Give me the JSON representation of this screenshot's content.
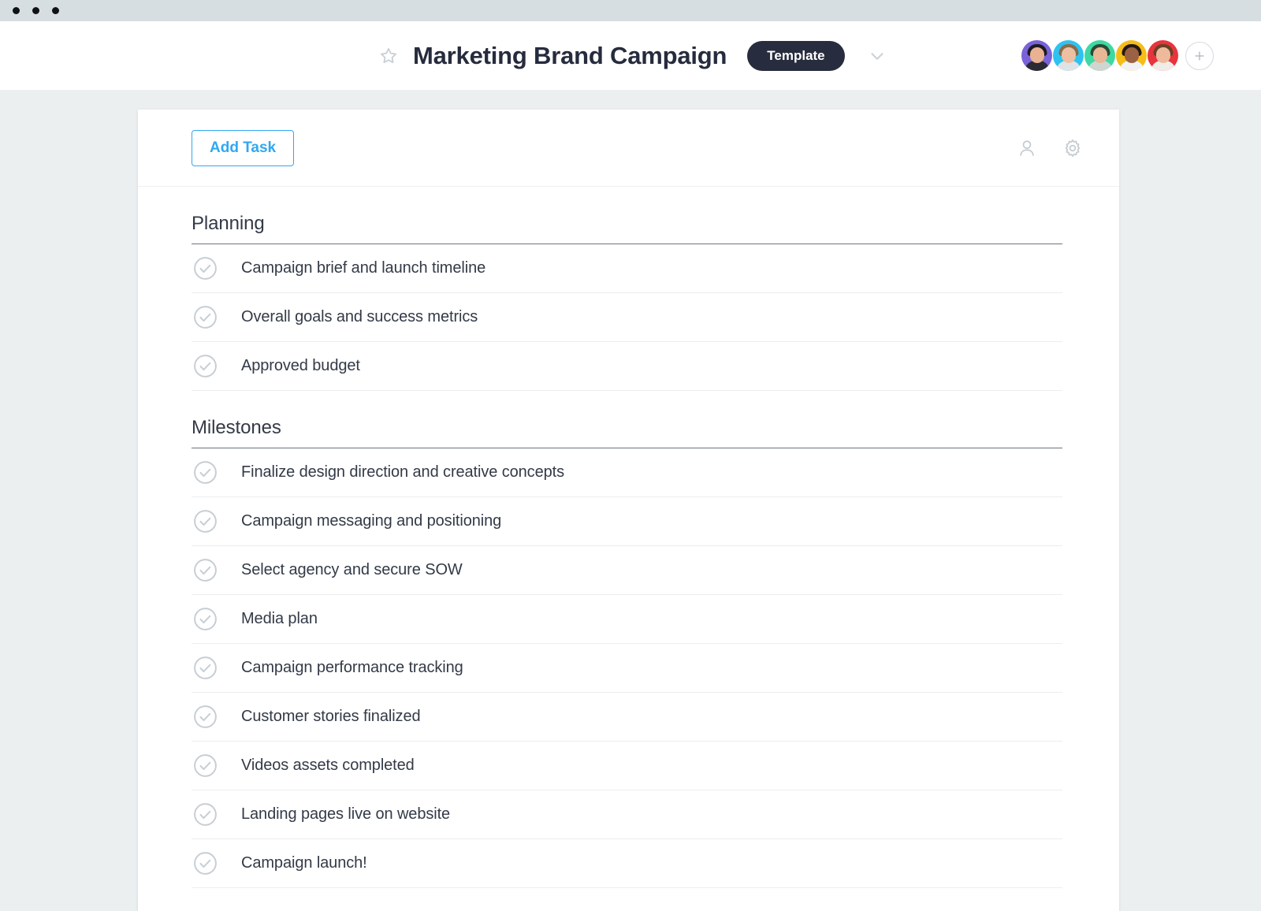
{
  "window": {
    "dots": 3
  },
  "header": {
    "star_icon": "star-outline-icon",
    "title": "Marketing Brand Campaign",
    "badge": "Template",
    "chevron_icon": "chevron-down-icon",
    "add_member_icon": "plus-icon",
    "avatars": [
      {
        "name": "member-1",
        "bg": "#7a62d8",
        "hair": "#1d1b22",
        "skin": "#e8b293",
        "body": "#2c2a33"
      },
      {
        "name": "member-2",
        "bg": "#2ec2f0",
        "hair": "#8b6a4a",
        "skin": "#edc0a4",
        "body": "#dfe3e6"
      },
      {
        "name": "member-3",
        "bg": "#3ed9a3",
        "hair": "#2d4a33",
        "skin": "#e8b796",
        "body": "#cfd6d2"
      },
      {
        "name": "member-4",
        "bg": "#f5bd16",
        "hair": "#241812",
        "skin": "#9a6242",
        "body": "#f2f2f2"
      },
      {
        "name": "member-5",
        "bg": "#e8343c",
        "hair": "#6a4127",
        "skin": "#edbb9c",
        "body": "#f0ece8"
      }
    ]
  },
  "toolbar": {
    "add_task_label": "Add Task",
    "person_icon": "person-icon",
    "settings_icon": "gear-icon"
  },
  "sections": [
    {
      "title": "Planning",
      "tasks": [
        "Campaign brief and launch timeline",
        "Overall goals and success metrics",
        "Approved budget"
      ]
    },
    {
      "title": "Milestones",
      "tasks": [
        "Finalize design direction and creative concepts",
        "Campaign messaging and positioning",
        "Select agency and secure SOW",
        "Media plan",
        "Campaign performance tracking",
        "Customer stories finalized",
        "Videos assets completed",
        "Landing pages live on website",
        "Campaign launch!"
      ]
    }
  ],
  "colors": {
    "accent_blue": "#2fa8f2",
    "badge_dark": "#272d3e",
    "page_bg": "#eceff0",
    "text_dark": "#333a47",
    "icon_gray": "#c3cbd1"
  }
}
